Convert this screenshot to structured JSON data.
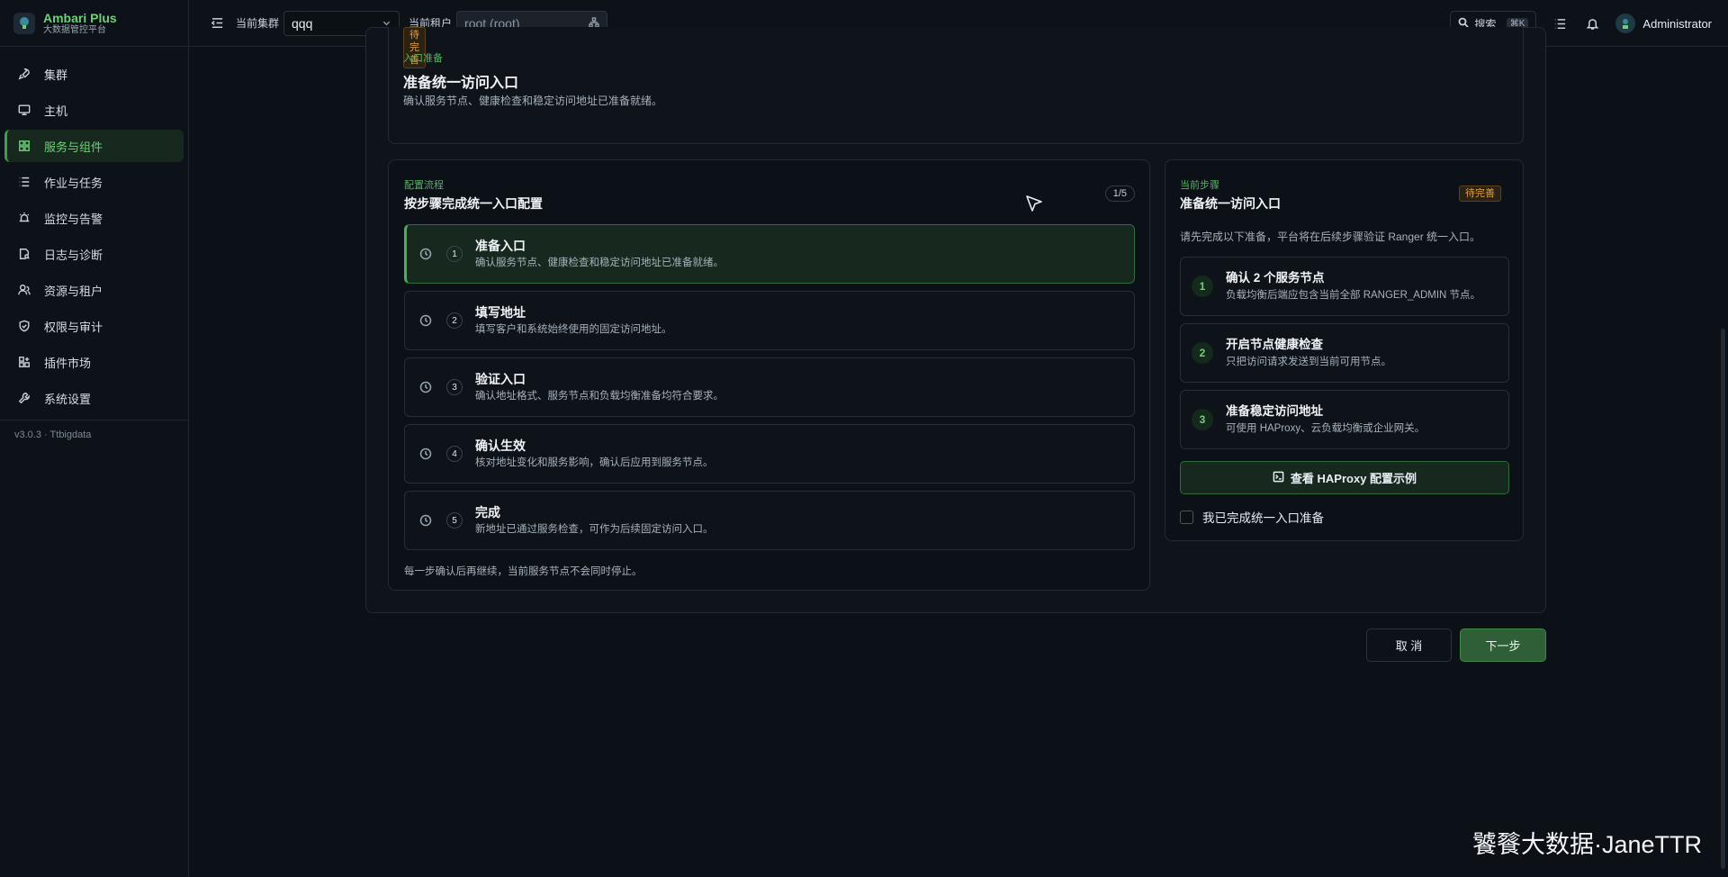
{
  "app": {
    "name": "Ambari Plus",
    "subtitle": "大数据管控平台",
    "version": "v3.0.3 · Ttbigdata"
  },
  "sidebar": {
    "items": [
      {
        "label": "集群",
        "icon": "rocket-icon"
      },
      {
        "label": "主机",
        "icon": "monitor-icon"
      },
      {
        "label": "服务与组件",
        "icon": "grid-icon",
        "active": true
      },
      {
        "label": "作业与任务",
        "icon": "list-icon"
      },
      {
        "label": "监控与告警",
        "icon": "alarm-icon"
      },
      {
        "label": "日志与诊断",
        "icon": "file-search-icon"
      },
      {
        "label": "资源与租户",
        "icon": "users-icon"
      },
      {
        "label": "权限与审计",
        "icon": "shield-icon"
      },
      {
        "label": "插件市场",
        "icon": "puzzle-icon"
      },
      {
        "label": "系统设置",
        "icon": "wrench-icon"
      }
    ]
  },
  "topbar": {
    "cluster_label": "当前集群",
    "cluster_value": "qqq",
    "tenant_label": "当前租户",
    "tenant_value": "root (root)",
    "search_label": "搜索",
    "search_shortcut": "⌘K",
    "user_name": "Administrator"
  },
  "intro": {
    "badge": "待完善",
    "eyebrow": "入口准备",
    "title": "准备统一访问入口",
    "desc": "确认服务节点、健康检查和稳定访问地址已准备就绪。"
  },
  "flow": {
    "eyebrow": "配置流程",
    "title": "按步骤完成统一入口配置",
    "counter": "1/5",
    "steps": [
      {
        "num": "1",
        "title": "准备入口",
        "desc": "确认服务节点、健康检查和稳定访问地址已准备就绪。"
      },
      {
        "num": "2",
        "title": "填写地址",
        "desc": "填写客户和系统始终使用的固定访问地址。"
      },
      {
        "num": "3",
        "title": "验证入口",
        "desc": "确认地址格式、服务节点和负载均衡准备均符合要求。"
      },
      {
        "num": "4",
        "title": "确认生效",
        "desc": "核对地址变化和服务影响，确认后应用到服务节点。"
      },
      {
        "num": "5",
        "title": "完成",
        "desc": "新地址已通过服务检查，可作为后续固定访问入口。"
      }
    ],
    "footer": "每一步确认后再继续，当前服务节点不会同时停止。"
  },
  "current": {
    "eyebrow": "当前步骤",
    "title": "准备统一访问入口",
    "badge": "待完善",
    "intro": "请先完成以下准备，平台将在后续步骤验证 Ranger 统一入口。",
    "items": [
      {
        "num": "1",
        "title": "确认 2 个服务节点",
        "desc": "负载均衡后端应包含当前全部 RANGER_ADMIN 节点。"
      },
      {
        "num": "2",
        "title": "开启节点健康检查",
        "desc": "只把访问请求发送到当前可用节点。"
      },
      {
        "num": "3",
        "title": "准备稳定访问地址",
        "desc": "可使用 HAProxy、云负载均衡或企业网关。"
      }
    ],
    "haproxy_button": "查看 HAProxy 配置示例",
    "confirm_label": "我已完成统一入口准备"
  },
  "actions": {
    "cancel": "取 消",
    "next": "下一步"
  },
  "watermark": "饕餮大数据·JaneTTR"
}
